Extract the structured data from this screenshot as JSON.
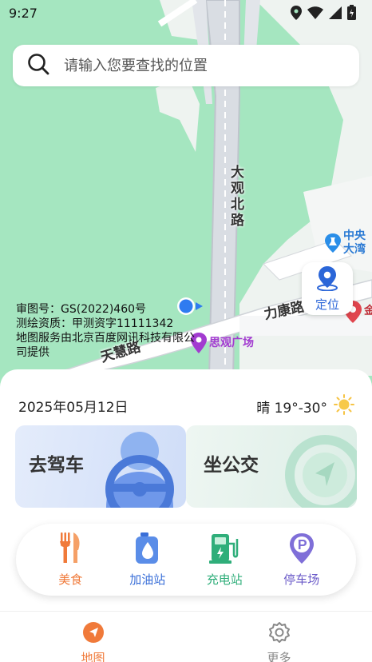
{
  "status": {
    "time": "9:27"
  },
  "search": {
    "placeholder": "请输入您要查找的位置"
  },
  "map": {
    "roads": [
      "大观北路",
      "力康路",
      "天慧路"
    ],
    "pois": [
      "中央大湾",
      "思观广场",
      "金"
    ],
    "credit_lines": [
      "审图号：GS(2022)460号",
      "测绘资质：甲测资字11111342",
      "地图服务由北京百度网讯科技有限公",
      "司提供"
    ]
  },
  "locate": {
    "label": "定位"
  },
  "info": {
    "date": "2025年05月12日",
    "weather": "晴 19°-30°"
  },
  "modes": [
    {
      "label": "去驾车"
    },
    {
      "label": "坐公交"
    }
  ],
  "services": [
    {
      "label": "美食",
      "icon": "fork-knife-icon",
      "color": "#f07a3a"
    },
    {
      "label": "加油站",
      "icon": "gas-drop-icon",
      "color": "#3a6fd8"
    },
    {
      "label": "充电站",
      "icon": "charging-pile-icon",
      "color": "#2fae7a"
    },
    {
      "label": "停车场",
      "icon": "parking-icon",
      "color": "#6a5ac8"
    }
  ],
  "nav": [
    {
      "label": "地图",
      "icon": "compass-icon",
      "active": true
    },
    {
      "label": "更多",
      "icon": "gear-icon",
      "active": false
    }
  ]
}
